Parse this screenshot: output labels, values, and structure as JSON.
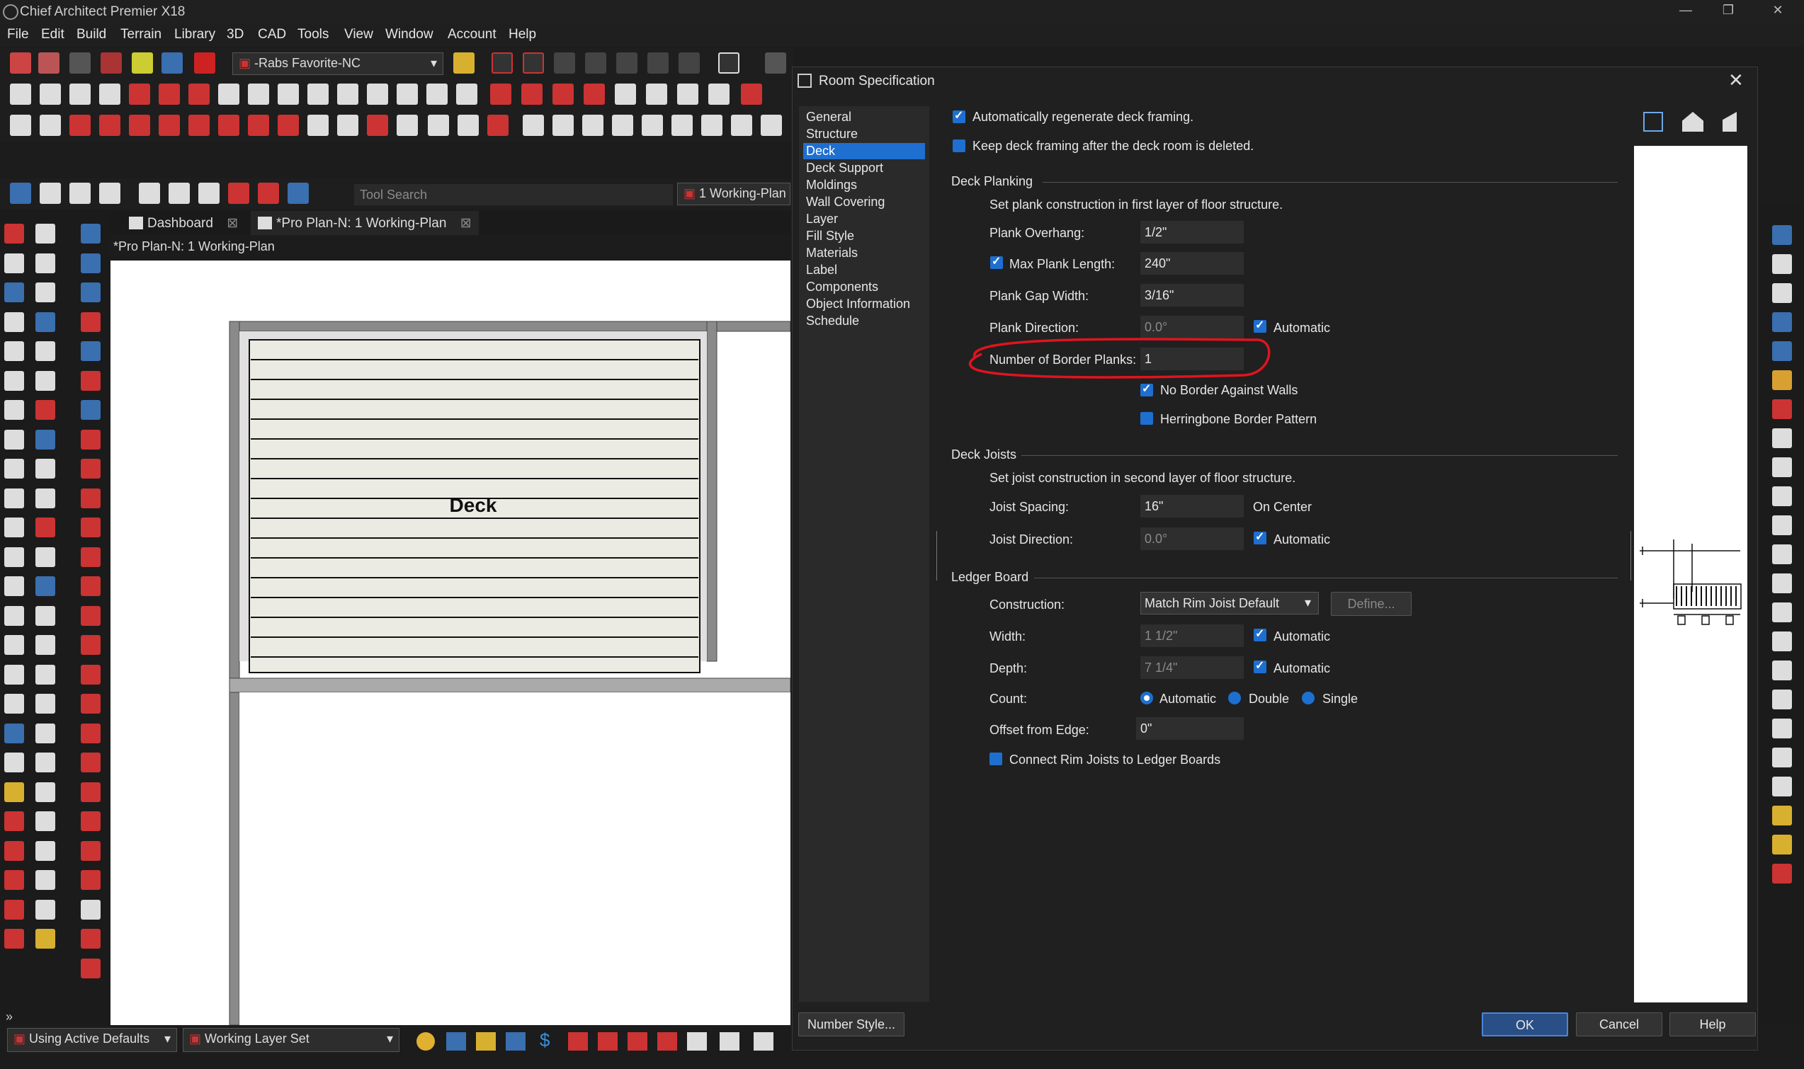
{
  "app": {
    "title": "Chief Architect Premier X18"
  },
  "menu": [
    "File",
    "Edit",
    "Build",
    "Terrain",
    "Library",
    "3D",
    "CAD",
    "Tools",
    "View",
    "Window",
    "Account",
    "Help"
  ],
  "toolbar": {
    "favorite_combo": "-Rabs Favorite-NC",
    "tool_search_placeholder": "Tool Search",
    "plan_combo": "1 Working-Plan"
  },
  "tabs": [
    {
      "label": "Dashboard"
    },
    {
      "label": "*Pro Plan-N: 1 Working-Plan"
    }
  ],
  "plan": {
    "title": "*Pro Plan-N: 1 Working-Plan",
    "room_label": "Deck"
  },
  "status": {
    "defaults": "Using Active Defaults",
    "layer_set": "Working Layer Set"
  },
  "dialog": {
    "title": "Room Specification",
    "nav": [
      "General",
      "Structure",
      "Deck",
      "Deck Support",
      "Moldings",
      "Wall Covering",
      "Layer",
      "Fill Style",
      "Materials",
      "Label",
      "Components",
      "Object Information",
      "Schedule"
    ],
    "selected_nav": "Deck",
    "auto_regen": "Automatically regenerate deck framing.",
    "keep_framing": "Keep deck framing after the deck room is deleted.",
    "planking": {
      "heading": "Deck Planking",
      "note": "Set plank construction in first layer of floor structure.",
      "overhang_label": "Plank Overhang:",
      "overhang": "1/2\"",
      "max_len_label": "Max Plank Length:",
      "max_len": "240\"",
      "gap_label": "Plank Gap Width:",
      "gap": "3/16\"",
      "dir_label": "Plank Direction:",
      "dir": "0.0°",
      "automatic": "Automatic",
      "border_label": "Number of Border Planks:",
      "border": "1",
      "no_border": "No Border Against Walls",
      "herringbone": "Herringbone Border Pattern"
    },
    "joists": {
      "heading": "Deck Joists",
      "note": "Set joist construction in second layer of floor structure.",
      "spacing_label": "Joist Spacing:",
      "spacing": "16\"",
      "on_center": "On Center",
      "dir_label": "Joist Direction:",
      "dir": "0.0°",
      "automatic": "Automatic"
    },
    "ledger": {
      "heading": "Ledger Board",
      "construction_label": "Construction:",
      "construction": "Match Rim Joist Default",
      "define": "Define...",
      "width_label": "Width:",
      "width": "1 1/2\"",
      "automatic": "Automatic",
      "depth_label": "Depth:",
      "depth": "7 1/4\"",
      "count_label": "Count:",
      "count_options": [
        "Automatic",
        "Double",
        "Single"
      ],
      "offset_label": "Offset from Edge:",
      "offset": "0\"",
      "connect": "Connect Rim Joists to Ledger Boards"
    },
    "buttons": {
      "number_style": "Number Style...",
      "ok": "OK",
      "cancel": "Cancel",
      "help": "Help"
    }
  },
  "colors": {
    "accent": "#1e6fd0",
    "annotation": "#e0141e",
    "deck_fill": "#ecebe3"
  }
}
